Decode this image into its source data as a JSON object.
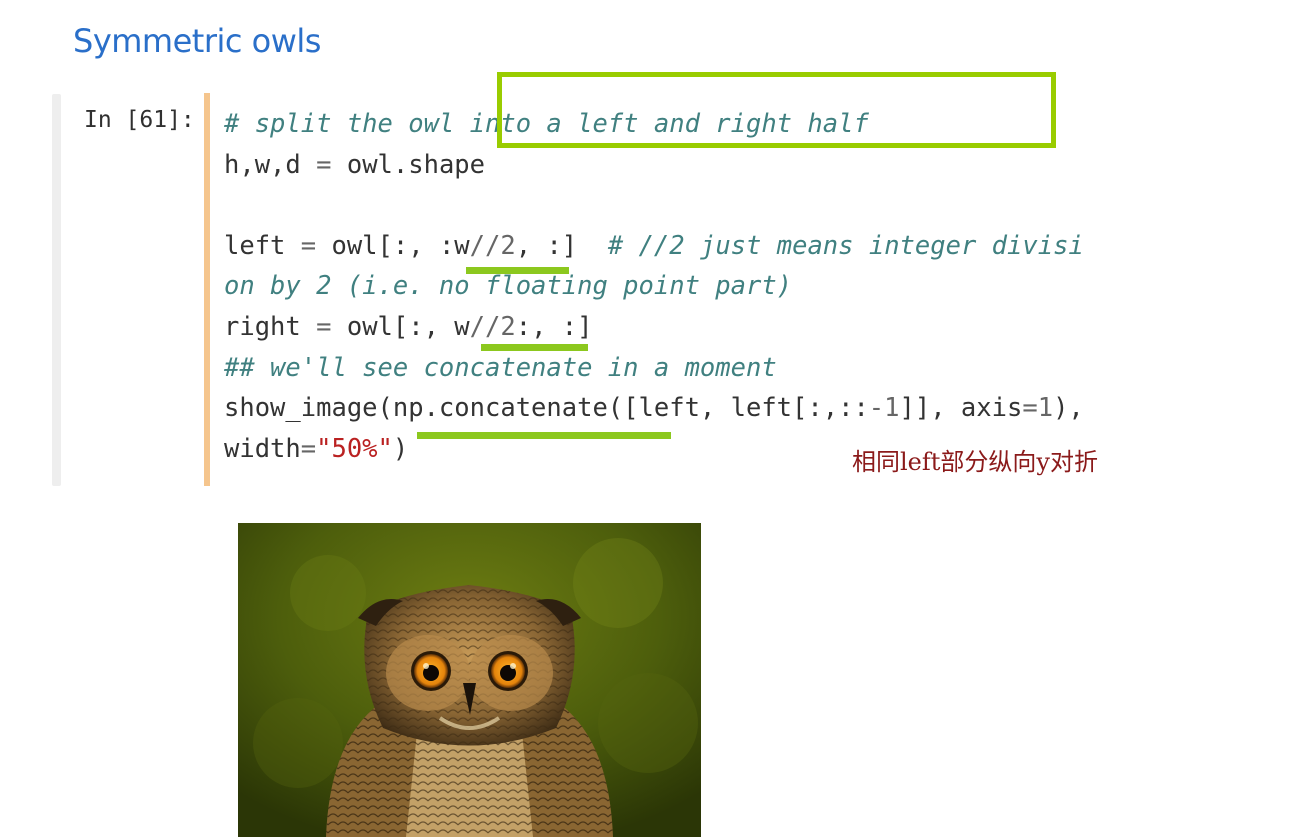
{
  "heading": "Symmetric owls",
  "cell": {
    "prompt": "In [61]:",
    "lines": [
      [
        {
          "t": "# split the owl into a left and right half",
          "k": "c"
        }
      ],
      [
        {
          "t": "h,w,d ",
          "k": ""
        },
        {
          "t": "=",
          "k": "o"
        },
        {
          "t": " owl.shape",
          "k": ""
        }
      ],
      [],
      [
        {
          "t": "left ",
          "k": ""
        },
        {
          "t": "=",
          "k": "o"
        },
        {
          "t": " owl[:, :w",
          "k": ""
        },
        {
          "t": "//",
          "k": "o"
        },
        {
          "t": "2",
          "k": "o"
        },
        {
          "t": ", :]  ",
          "k": ""
        },
        {
          "t": "# //2 just means integer divisi",
          "k": "c"
        }
      ],
      [
        {
          "t": "on by 2 (i.e. no floating point part)",
          "k": "c"
        }
      ],
      [
        {
          "t": "right ",
          "k": ""
        },
        {
          "t": "=",
          "k": "o"
        },
        {
          "t": " owl[:, w",
          "k": ""
        },
        {
          "t": "//",
          "k": "o"
        },
        {
          "t": "2",
          "k": "o"
        },
        {
          "t": ":, :]",
          "k": ""
        }
      ],
      [
        {
          "t": "## we'll see concatenate in a moment",
          "k": "c"
        }
      ],
      [
        {
          "t": "show_image(np.concatenate([left, left[:,::",
          "k": ""
        },
        {
          "t": "-1",
          "k": "o"
        },
        {
          "t": "]], axis",
          "k": ""
        },
        {
          "t": "=",
          "k": "o"
        },
        {
          "t": "1",
          "k": "o"
        },
        {
          "t": "),",
          "k": ""
        }
      ],
      [
        {
          "t": "width",
          "k": ""
        },
        {
          "t": "=",
          "k": "o"
        },
        {
          "t": "\"50%\"",
          "k": "s"
        },
        {
          "t": ")",
          "k": ""
        }
      ]
    ]
  },
  "annotation": {
    "note": "相同left部分纵向y对折",
    "highlight_color": "#99cc00"
  },
  "output": {
    "image_icon": "owl-photo"
  }
}
